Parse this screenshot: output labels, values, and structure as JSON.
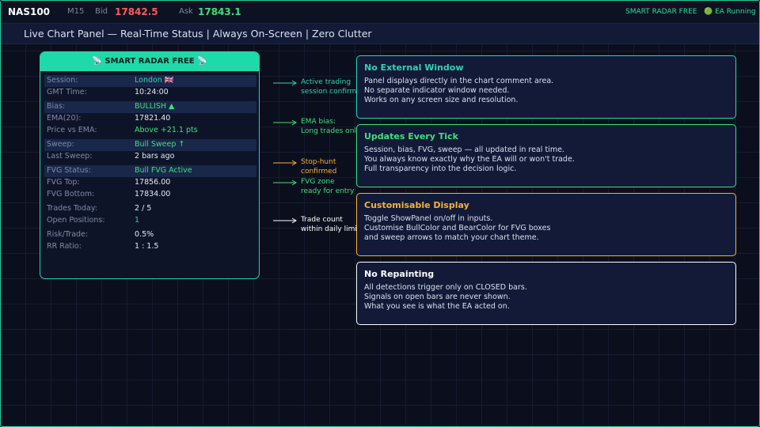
{
  "header": {
    "symbol": "NAS100",
    "timeframe": "M15",
    "bid_label": "Bid",
    "bid_value": "17842.5",
    "ask_label": "Ask",
    "ask_value": "17843.1",
    "product": "SMART RADAR  FREE",
    "status": "🟢 EA Running"
  },
  "subtitle": "Live Chart Panel  —  Real-Time Status  |  Always On-Screen  |  Zero Clutter",
  "panel": {
    "title": "📡 SMART RADAR FREE 📡",
    "rows": [
      {
        "key": "Session:",
        "value": "London 🇬🇧"
      },
      {
        "key": "GMT Time:",
        "value": "10:24:00"
      },
      {
        "key": "Bias:",
        "value": "BULLISH  ▲"
      },
      {
        "key": "EMA(20):",
        "value": "17821.40"
      },
      {
        "key": "Price vs EMA:",
        "value": "Above +21.1 pts"
      },
      {
        "key": "Sweep:",
        "value": "Bull Sweep  ↑"
      },
      {
        "key": "Last Sweep:",
        "value": "2 bars ago"
      },
      {
        "key": "FVG Status:",
        "value": "Bull FVG Active"
      },
      {
        "key": "FVG Top:",
        "value": "17856.00"
      },
      {
        "key": "FVG Bottom:",
        "value": "17834.00"
      },
      {
        "key": "Trades Today:",
        "value": "2 / 5"
      },
      {
        "key": "Open Positions:",
        "value": "1"
      },
      {
        "key": "Risk/Trade:",
        "value": "0.5%"
      },
      {
        "key": "RR Ratio:",
        "value": "1 : 1.5"
      }
    ]
  },
  "annotations": [
    {
      "text": [
        "Active trading",
        "session confirmed"
      ],
      "color": "#2fd3b0"
    },
    {
      "text": [
        "EMA bias:",
        "Long trades only"
      ],
      "color": "#3ee07b"
    },
    {
      "text": [
        "Stop-hunt",
        "confirmed"
      ],
      "color": "#f5b236"
    },
    {
      "text": [
        "FVG zone",
        "ready for entry"
      ],
      "color": "#3ee07b"
    },
    {
      "text": [
        "Trade count",
        "within daily limit"
      ],
      "color": "#ffffff"
    }
  ],
  "cards": [
    {
      "title": "No External Window",
      "color": "#2fd3b0",
      "lines": [
        "Panel displays directly in the chart comment area.",
        "No separate indicator window needed.",
        "Works on any screen size and resolution."
      ]
    },
    {
      "title": "Updates Every Tick",
      "color": "#3ee07b",
      "lines": [
        "Session, bias, FVG, sweep — all updated in real time.",
        "You always know exactly why the EA will or won't trade.",
        "Full transparency into the decision logic."
      ]
    },
    {
      "title": "Customisable Display",
      "color": "#f5b236",
      "lines": [
        "Toggle ShowPanel on/off in inputs.",
        "Customise BullColor and BearColor for FVG boxes",
        "and sweep arrows to match your chart theme."
      ]
    },
    {
      "title": "No Repainting",
      "color": "#ffffff",
      "lines": [
        "All detections trigger only on CLOSED bars.",
        "Signals on open bars are never shown.",
        "What you see is what the EA acted on."
      ]
    }
  ]
}
